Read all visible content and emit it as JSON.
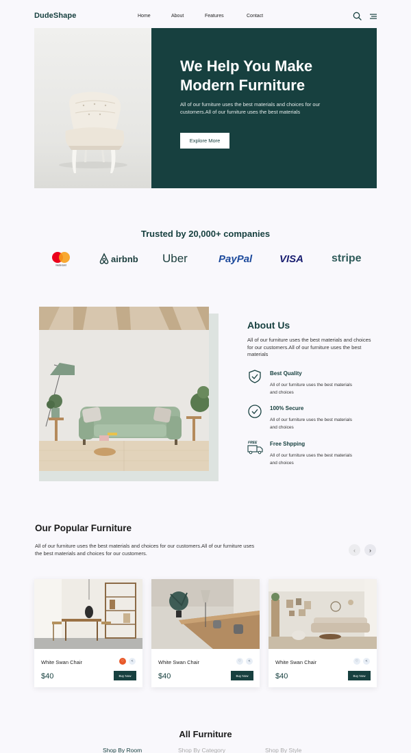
{
  "nav": {
    "logo": "DudeShape",
    "links": [
      "Home",
      "About",
      "Features",
      "Contact"
    ],
    "search_icon": "search-icon",
    "menu_icon": "menu-icon"
  },
  "hero": {
    "title": "We Help You Make Modern Furniture",
    "description": "All of our furniture uses the best materials and choices for our customers.All of our furniture uses the best materials",
    "button": "Explore More"
  },
  "trusted": {
    "title": "Trusted by 20,000+ companies",
    "brands": [
      "mastercard",
      "airbnb",
      "Uber",
      "PayPal",
      "VISA",
      "stripe"
    ]
  },
  "about": {
    "title": "About Us",
    "description": "All of our furniture uses the best materials and choices for our customers.All of our furniture uses the best materials",
    "features": [
      {
        "icon": "shield-check-icon",
        "title": "Best Quality",
        "desc": "All of our furniture uses the best materials and choices"
      },
      {
        "icon": "check-circle-icon",
        "title": "100% Secure",
        "desc": "All of our furniture uses the best materials and choices"
      },
      {
        "icon": "free-truck-icon",
        "title": "Free Shpping",
        "desc": "All of our furniture uses the best materials and choices",
        "badge": "FREE"
      }
    ]
  },
  "popular": {
    "title": "Our Popular Furniture",
    "description": "All of our furniture uses the best materials and choices for our customers.All of our furniture uses the best materials and choices for our customers.",
    "cards": [
      {
        "name": "White Swan Chair",
        "price": "$40",
        "button": "Buy Now",
        "liked": true
      },
      {
        "name": "White Swan Chair",
        "price": "$40",
        "button": "Buy Now",
        "liked": false
      },
      {
        "name": "White Swan Chair",
        "price": "$40",
        "button": "Buy Now",
        "liked": false
      }
    ]
  },
  "all_furniture": {
    "title": "All Furniture",
    "tabs": [
      "Shop By Room",
      "Shop By Category",
      "Shop By Style"
    ],
    "active_tab": 0
  },
  "colors": {
    "primary": "#17403f",
    "background": "#f9f8fc",
    "accent": "#e8592a"
  }
}
